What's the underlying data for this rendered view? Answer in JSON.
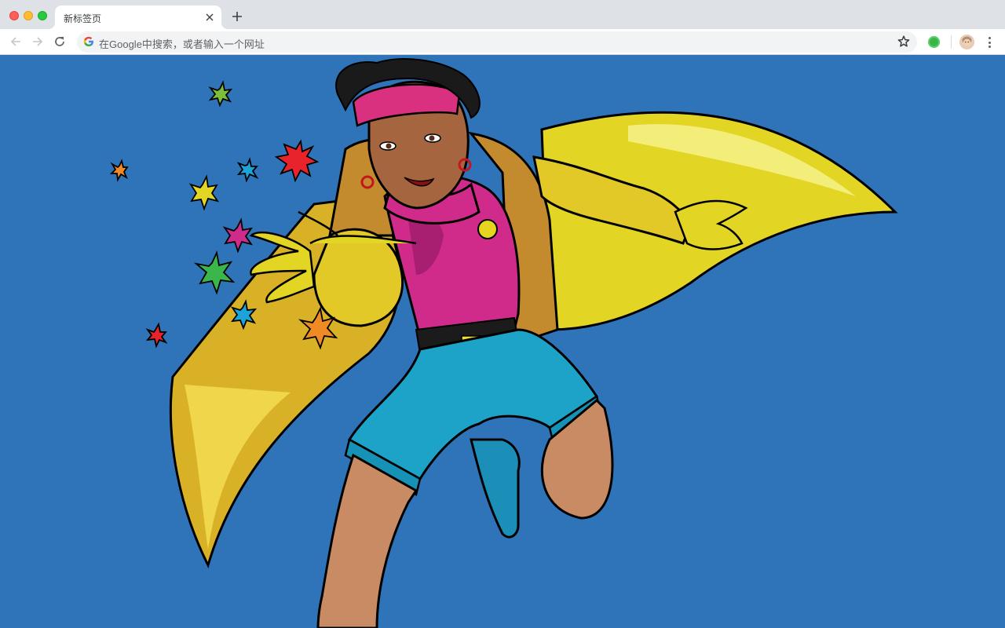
{
  "browser": {
    "tab": {
      "title": "新标签页",
      "close_icon": "close-icon"
    },
    "new_tab_icon": "plus-icon",
    "nav": {
      "back_icon": "arrow-left-icon",
      "forward_icon": "arrow-right-icon",
      "reload_icon": "reload-icon"
    },
    "omnibox": {
      "placeholder": "在Google中搜索，或者输入一个网址",
      "search_engine_icon": "google-g-icon",
      "bookmark_icon": "star-icon"
    },
    "extension_icon": "green-extension-icon",
    "profile_icon": "avatar",
    "menu_icon": "kebab-menu-icon"
  },
  "page": {
    "background_color": "#2f74b8",
    "wallpaper": "comic superhero illustration"
  }
}
